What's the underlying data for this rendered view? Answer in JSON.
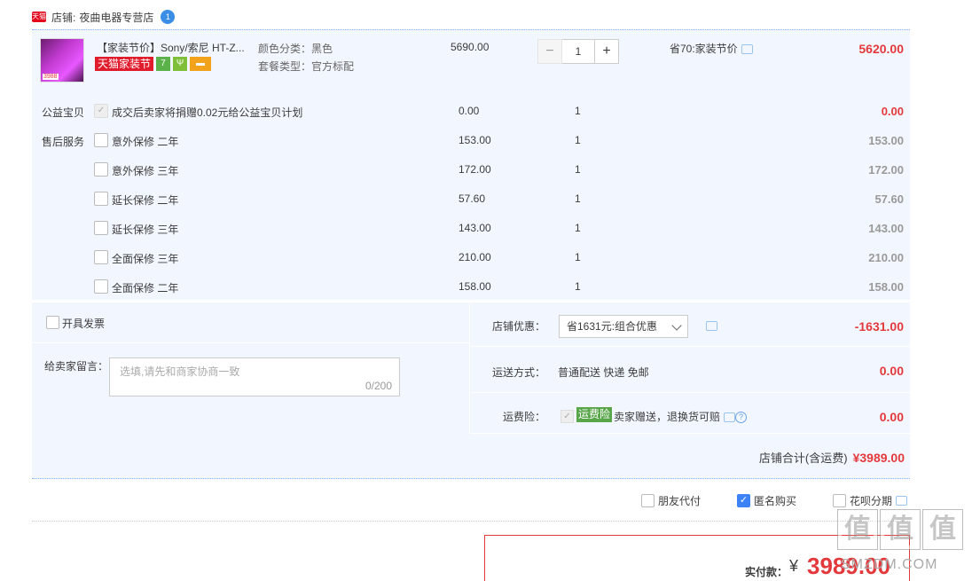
{
  "shop": {
    "badge": "天猫",
    "label": "店铺:",
    "name": "夜曲电器专营店",
    "ww_icon": "1"
  },
  "product": {
    "thumb_price": "3988",
    "title": "【家装节价】Sony/索尼 HT-Z...",
    "tag": "天猫家装节",
    "tag2": "7",
    "tag3": "Ψ",
    "color": "颜色分类：黑色",
    "package": "套餐类型：官方标配",
    "unit_price": "5690.00",
    "qty": "1",
    "minus": "−",
    "plus": "+",
    "discount_note": "省70:家装节价",
    "total": "5620.00"
  },
  "charity": {
    "category": "公益宝贝",
    "text": "成交后卖家将捐赠0.02元给公益宝贝计划",
    "price": "0.00",
    "qty": "1",
    "total": "0.00",
    "check": "✓"
  },
  "aftersale": {
    "category": "售后服务",
    "items": [
      {
        "name": "意外保修 二年",
        "price": "153.00",
        "qty": "1",
        "total": "153.00"
      },
      {
        "name": "意外保修 三年",
        "price": "172.00",
        "qty": "1",
        "total": "172.00"
      },
      {
        "name": "延长保修 二年",
        "price": "57.60",
        "qty": "1",
        "total": "57.60"
      },
      {
        "name": "延长保修 三年",
        "price": "143.00",
        "qty": "1",
        "total": "143.00"
      },
      {
        "name": "全面保修 三年",
        "price": "210.00",
        "qty": "1",
        "total": "210.00"
      },
      {
        "name": "全面保修 二年",
        "price": "158.00",
        "qty": "1",
        "total": "158.00"
      }
    ]
  },
  "invoice": {
    "label": "开具发票"
  },
  "memo": {
    "label": "给卖家留言：",
    "placeholder": "选填,请先和商家协商一致",
    "count": "0/200"
  },
  "coupon": {
    "label": "店铺优惠：",
    "value": "省1631元:组合优惠",
    "total": "-1631.00"
  },
  "shipping": {
    "label": "运送方式：",
    "value": "普通配送 快递 免邮",
    "total": "0.00"
  },
  "insurance": {
    "label": "运费险：",
    "tag": "运费险",
    "desc": "卖家赠送，退换货可赔",
    "total": "0.00",
    "check": "✓",
    "help": "?"
  },
  "shop_total": {
    "label": "店铺合计(含运费)",
    "amount": "¥3989.00"
  },
  "options": {
    "friend_pay": "朋友代付",
    "anonymous": "匿名购买",
    "anonymous_check": "✓",
    "huabei": "花呗分期"
  },
  "payment": {
    "label": "实付款：",
    "yen": "¥",
    "amount": "3989.00"
  },
  "watermark": {
    "chars": [
      "值",
      "值",
      "值"
    ],
    "text": "SMZDM.COM"
  }
}
